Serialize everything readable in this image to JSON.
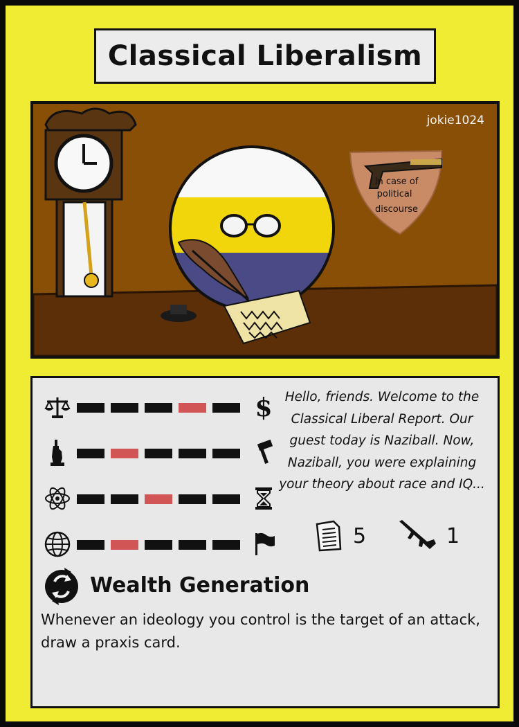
{
  "card": {
    "title": "Classical Liberalism",
    "artist": "jokie1024",
    "art": {
      "plaque_text": [
        "In case of",
        "political",
        "discourse"
      ]
    },
    "axes": [
      {
        "left_icon": "scales-icon",
        "right_icon": "dollar-icon",
        "active_segment": 4,
        "segments": 5
      },
      {
        "left_icon": "liberty-statue-icon",
        "right_icon": "gavel-icon",
        "active_segment": 2,
        "segments": 5
      },
      {
        "left_icon": "atom-icon",
        "right_icon": "hourglass-icon",
        "active_segment": 3,
        "segments": 5
      },
      {
        "left_icon": "globe-icon",
        "right_icon": "flag-icon",
        "active_segment": 2,
        "segments": 5
      }
    ],
    "flavor_text": "Hello, friends. Welcome to the Classical Liberal Report. Our guest today is Naziball. Now, Naziball, you were explaining your theory about race and IQ...",
    "stats": {
      "document_value": "5",
      "rifle_value": "1"
    },
    "ability": {
      "icon": "refresh-cycle-icon",
      "name": "Wealth Generation",
      "text": "Whenever an ideology you control is the target of an attack, draw a praxis card."
    },
    "colors": {
      "card_background": "#f0ec34",
      "panel_background": "#e8e8e8",
      "active_segment": "#d25555",
      "segment": "#111111",
      "art_background": "#8a4f07"
    }
  }
}
